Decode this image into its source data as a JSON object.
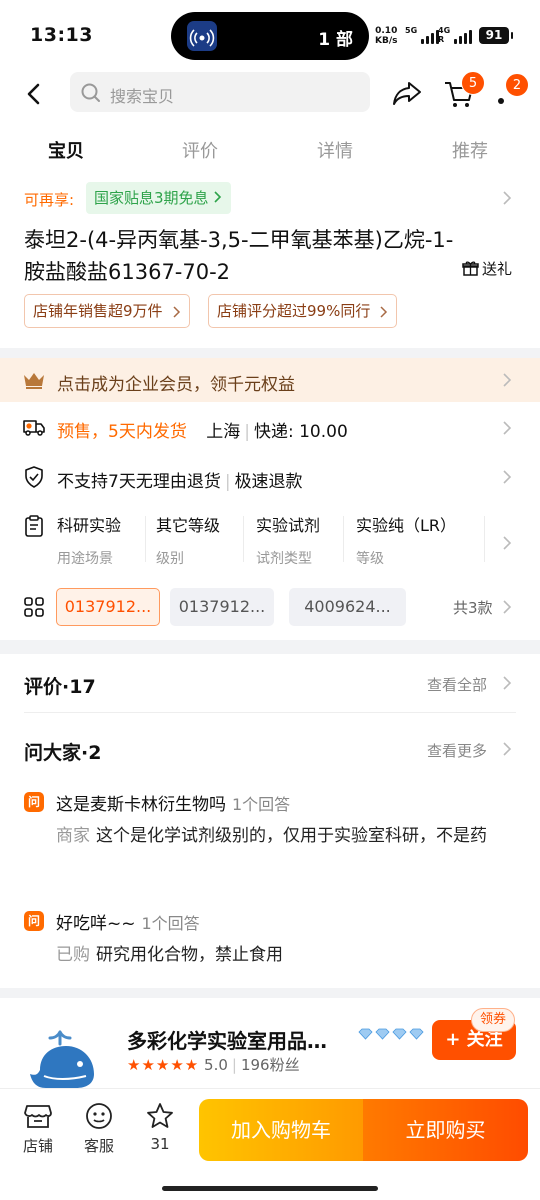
{
  "status_bar": {
    "time": "13:13",
    "island_text": "1 部",
    "net_speed_value": "0.10",
    "net_speed_unit": "KB/s",
    "sig1_label": "5G",
    "sig2_label": "4G",
    "sig2_sub": "R",
    "battery": "91"
  },
  "header": {
    "search_placeholder": "搜索宝贝",
    "cart_badge": "5",
    "more_badge": "2"
  },
  "tabs": [
    {
      "label": "宝贝",
      "active": true
    },
    {
      "label": "评价",
      "active": false
    },
    {
      "label": "详情",
      "active": false
    },
    {
      "label": "推荐",
      "active": false
    }
  ],
  "product": {
    "subsidy_prefix": "可再享:",
    "subsidy_chip": "国家贴息3期免息",
    "title": "泰坦2-(4-异丙氧基-3,5-二甲氧基苯基)乙烷-1-胺盐酸盐61367-70-2",
    "gift_label": "送礼",
    "pills": [
      "店铺年销售超9万件",
      "店铺评分超过99%同行"
    ]
  },
  "member_bar": {
    "text": "点击成为企业会员，领千元权益"
  },
  "shipping": {
    "presale": "预售，5天内发货",
    "location": "上海",
    "express": "快递: 10.00"
  },
  "returns": {
    "text": "不支持7天无理由退货",
    "refund": "极速退款"
  },
  "specs": [
    {
      "value": "科研实验",
      "key": "用途场景"
    },
    {
      "value": "其它等级",
      "key": "级别"
    },
    {
      "value": "实验试剂",
      "key": "试剂类型"
    },
    {
      "value": "实验纯（LR）",
      "key": "等级"
    }
  ],
  "skus": {
    "items": [
      "0137912...",
      "0137912...",
      "4009624..."
    ],
    "count_label": "共3款"
  },
  "reviews": {
    "title": "评价·17",
    "more": "查看全部"
  },
  "qa": {
    "title": "问大家·2",
    "more": "查看更多",
    "icon_text": "问",
    "items": [
      {
        "question": "这是麦斯卡林衍生物吗",
        "count": "1个回答",
        "answer_label": "商家",
        "answer": "这个是化学试剂级别的，仅用于实验室科研，不是药"
      },
      {
        "question": "好吃咩~~",
        "count": "1个回答",
        "answer_label": "已购",
        "answer": "研究用化合物，禁止食用"
      }
    ]
  },
  "store": {
    "name": "多彩化学实验室用品…",
    "rating": "5.0",
    "followers": "196粉丝",
    "follow_label": "+ 关注",
    "coupon_label": "领券"
  },
  "bottom_bar": {
    "store_label": "店铺",
    "service_label": "客服",
    "fav_count": "31",
    "add_cart_label": "加入购物车",
    "buy_label": "立即购买"
  },
  "colors": {
    "accent": "#ff5000",
    "subsidy_green": "#2ea34a",
    "member_bg": "#fdf0e4"
  }
}
